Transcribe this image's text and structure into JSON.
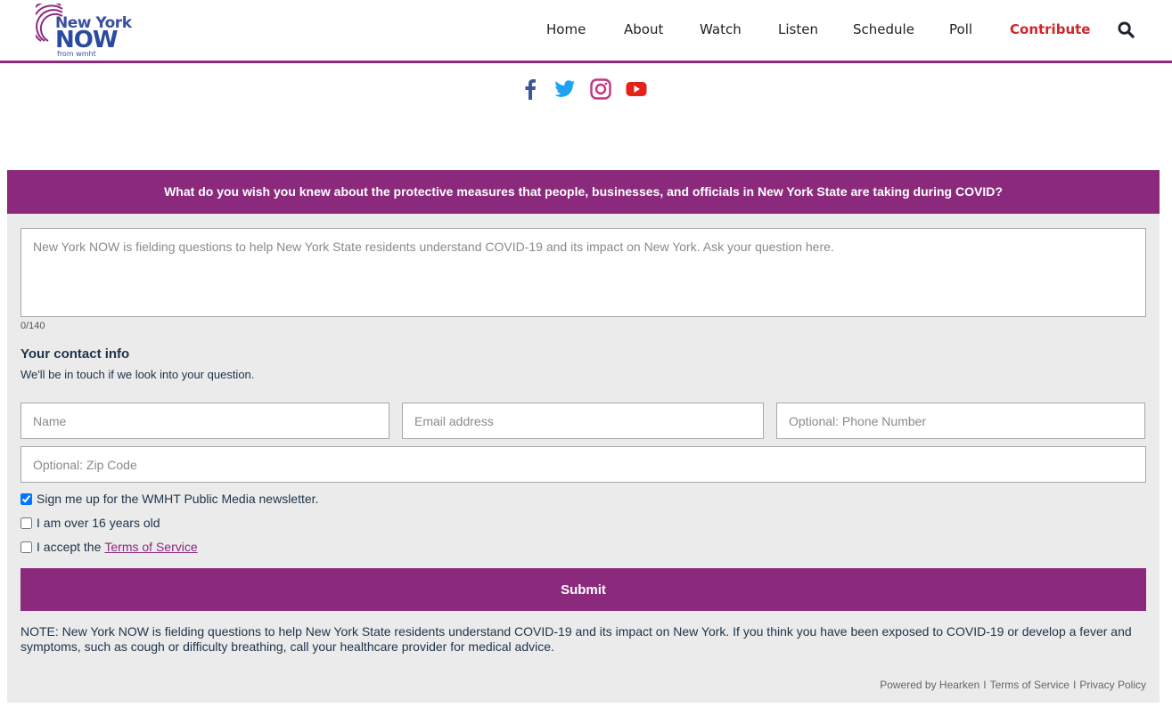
{
  "header": {
    "logo": {
      "line1": "New York",
      "line2": "NOW",
      "line3": "from wmht"
    },
    "nav": [
      {
        "label": "Home"
      },
      {
        "label": "About"
      },
      {
        "label": "Watch"
      },
      {
        "label": "Listen"
      },
      {
        "label": "Schedule"
      },
      {
        "label": "Poll"
      },
      {
        "label": "Contribute"
      }
    ],
    "search_icon": "search-icon",
    "accent_color": "#8b2a7d",
    "contribute_color": "#d0262b"
  },
  "social": [
    {
      "icon": "facebook-icon",
      "color": "#3b5998"
    },
    {
      "icon": "twitter-icon",
      "color": "#1da1f2"
    },
    {
      "icon": "instagram-icon",
      "color": "#c13584"
    },
    {
      "icon": "youtube-icon",
      "color": "#e62117"
    }
  ],
  "form": {
    "header": "What do you wish you knew about the protective measures that people, businesses, and officials in New York State are taking during COVID?",
    "question_placeholder": "New York NOW is fielding questions to help New York State residents understand COVID-19 and its impact on New York. Ask your question here.",
    "question_value": "",
    "char_count": "0/140",
    "contact_title": "Your contact info",
    "contact_subtitle": "We'll be in touch if we look into your question.",
    "name_placeholder": "Name",
    "email_placeholder": "Email address",
    "phone_placeholder": "Optional: Phone Number",
    "zip_placeholder": "Optional: Zip Code",
    "checkboxes": {
      "newsletter": {
        "label": "Sign me up for the WMHT Public Media newsletter.",
        "checked": true
      },
      "age": {
        "label": "I am over 16 years old",
        "checked": false
      },
      "terms": {
        "label": "I accept the",
        "link": "Terms of Service",
        "checked": false
      }
    },
    "submit_label": "Submit",
    "note": "NOTE: New York NOW is fielding questions to help New York State residents understand COVID-19 and its impact on New York. If you think you have been exposed to COVID-19 or develop a fever and symptoms, such as cough or difficulty breathing, call your healthcare provider for medical advice.",
    "footer": {
      "powered_by": "Powered by Hearken",
      "sep": "I",
      "terms": "Terms of Service",
      "privacy": "Privacy Policy"
    }
  }
}
